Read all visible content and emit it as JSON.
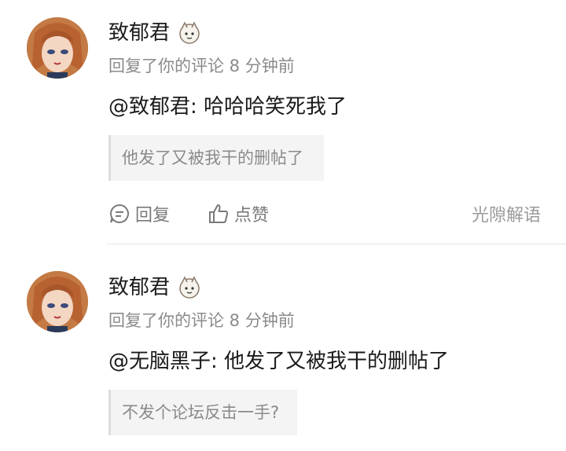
{
  "comments": [
    {
      "author": "致郁君",
      "meta": "回复了你的评论 8 分钟前",
      "content": "@致郁君: 哈哈哈笑死我了",
      "quote": "他发了又被我干的删帖了",
      "reply_label": "回复",
      "like_label": "点赞",
      "source": "光隙解语"
    },
    {
      "author": "致郁君",
      "meta": "回复了你的评论 8 分钟前",
      "content": "@无脑黑子: 他发了又被我干的删帖了",
      "quote": "不发个论坛反击一手?"
    }
  ],
  "icons": {
    "avatar": "anime-girl-avatar",
    "badge": "mascot-badge-icon",
    "reply": "comment-bubble-icon",
    "like": "thumbs-up-icon"
  }
}
